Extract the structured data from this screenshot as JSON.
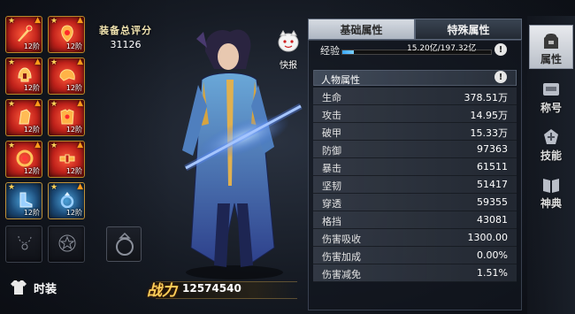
{
  "equipment": {
    "slots": [
      {
        "level": "12阶",
        "stars": "★",
        "upgrade": "▲",
        "rarity": "red",
        "icon": "crystal-staff-icon"
      },
      {
        "level": "12阶",
        "stars": "★",
        "upgrade": "▲",
        "rarity": "red",
        "icon": "amulet-icon"
      },
      {
        "level": "12阶",
        "stars": "★",
        "upgrade": "▲",
        "rarity": "red",
        "icon": "helmet-icon"
      },
      {
        "level": "12阶",
        "stars": "★",
        "upgrade": "▲",
        "rarity": "red",
        "icon": "shoulder-armor-icon"
      },
      {
        "level": "12阶",
        "stars": "★",
        "upgrade": "▲",
        "rarity": "red",
        "icon": "gauntlet-icon"
      },
      {
        "level": "12阶",
        "stars": "★",
        "upgrade": "▲",
        "rarity": "red",
        "icon": "chest-armor-icon"
      },
      {
        "level": "12阶",
        "stars": "★",
        "upgrade": "▲",
        "rarity": "red",
        "icon": "bracer-icon"
      },
      {
        "level": "12阶",
        "stars": "★",
        "upgrade": "▲",
        "rarity": "red",
        "icon": "belt-icon"
      },
      {
        "level": "12阶",
        "stars": "★",
        "upgrade": "",
        "rarity": "blue",
        "icon": "boots-icon"
      },
      {
        "level": "12阶",
        "stars": "★",
        "upgrade": "▲",
        "rarity": "blue",
        "icon": "ring-icon"
      }
    ],
    "empty_slots": [
      "necklace-outline-icon",
      "emblem-outline-icon"
    ]
  },
  "gear_score": {
    "label": "装备总评分",
    "value": "31126"
  },
  "fashion": {
    "label": "时装"
  },
  "power": {
    "label": "战力",
    "value": "12574540"
  },
  "quick_report": {
    "label": "快报"
  },
  "tabs": {
    "basic": "基础属性",
    "special": "特殊属性"
  },
  "experience": {
    "label": "经验",
    "value": "15.20亿/197.32亿",
    "fraction": 0.077
  },
  "help_icon": "!",
  "section": {
    "title": "人物属性"
  },
  "stats": [
    {
      "name": "生命",
      "value": "378.51万"
    },
    {
      "name": "攻击",
      "value": "14.95万"
    },
    {
      "name": "破甲",
      "value": "15.33万"
    },
    {
      "name": "防御",
      "value": "97363"
    },
    {
      "name": "暴击",
      "value": "61511"
    },
    {
      "name": "坚韧",
      "value": "51417"
    },
    {
      "name": "穿透",
      "value": "59355"
    },
    {
      "name": "格挡",
      "value": "43081"
    },
    {
      "name": "伤害吸收",
      "value": "1300.00"
    },
    {
      "name": "伤害加成",
      "value": "0.00%"
    },
    {
      "name": "伤害减免",
      "value": "1.51%"
    }
  ],
  "nav": [
    {
      "label": "属性",
      "icon": "backpack-icon",
      "active": true
    },
    {
      "label": "称号",
      "icon": "title-badge-icon",
      "active": false
    },
    {
      "label": "技能",
      "icon": "skill-icon",
      "active": false
    },
    {
      "label": "神典",
      "icon": "divine-tome-icon",
      "active": false
    }
  ],
  "colors": {
    "rarity_red": "#c0221b",
    "rarity_blue": "#1d4d7a",
    "gold_text": "#ffcf5a",
    "exp_fill": "#3aa8ff"
  }
}
